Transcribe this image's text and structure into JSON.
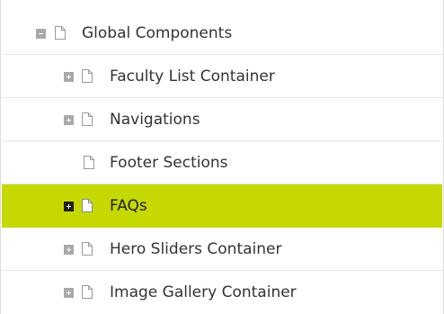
{
  "tree": {
    "items": [
      {
        "label": "Global Components",
        "level": 0,
        "toggle": "minus",
        "selected": false
      },
      {
        "label": "Faculty List Container",
        "level": 1,
        "toggle": "plus",
        "selected": false
      },
      {
        "label": "Navigations",
        "level": 1,
        "toggle": "plus",
        "selected": false
      },
      {
        "label": "Footer Sections",
        "level": 1,
        "toggle": "none",
        "selected": false
      },
      {
        "label": "FAQs",
        "level": 1,
        "toggle": "plus",
        "selected": true
      },
      {
        "label": "Hero Sliders Container",
        "level": 1,
        "toggle": "plus",
        "selected": false
      },
      {
        "label": "Image Gallery Container",
        "level": 1,
        "toggle": "plus",
        "selected": false
      }
    ]
  },
  "colors": {
    "selected_background": "#c5d800",
    "toggle_default": "#a9a9a9",
    "toggle_selected": "#1f1f1f",
    "text": "#333333"
  },
  "icons": {
    "toggle_collapsed": "plus-square-icon",
    "toggle_expanded": "minus-square-icon",
    "node": "document-icon"
  }
}
